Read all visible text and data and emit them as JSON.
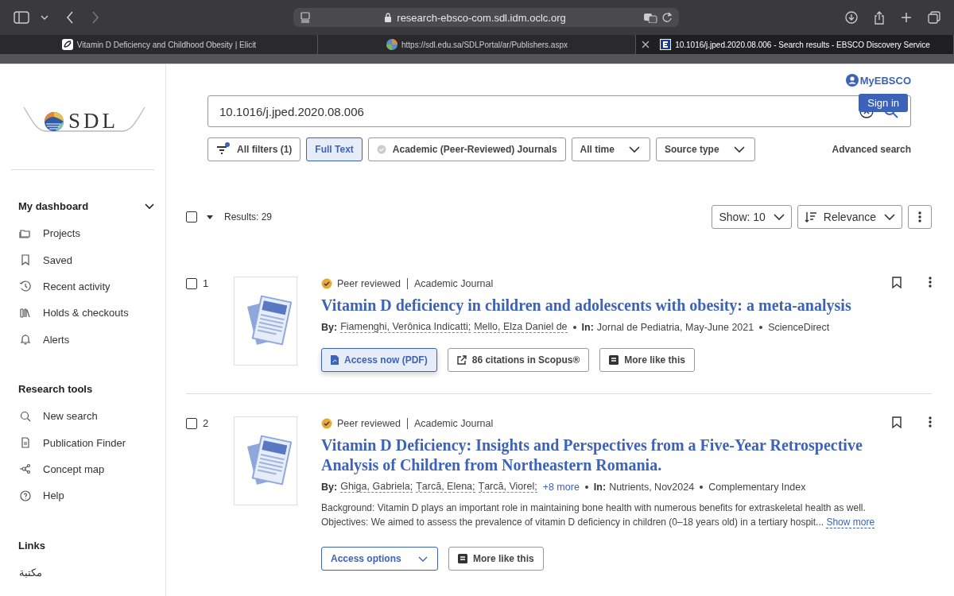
{
  "browser": {
    "url": "research-ebsco-com.sdl.idm.oclc.org",
    "tabs": [
      {
        "title": "Vitamin D Deficiency and Childhood Obesity | Elicit",
        "selected": false,
        "close_visible": false
      },
      {
        "title": "https://sdl.edu.sa/SDLPortal/ar/Publishers.aspx",
        "selected": false,
        "close_visible": false
      },
      {
        "title": "10.1016/j.jped.2020.08.006 - Search results - EBSCO Discovery Service",
        "selected": true,
        "close_visible": true
      }
    ]
  },
  "sidebar": {
    "logo": "SDL",
    "sections": [
      {
        "heading": "My dashboard",
        "expanded": true,
        "items": [
          {
            "label": "Projects"
          },
          {
            "label": "Saved"
          },
          {
            "label": "Recent activity"
          },
          {
            "label": "Holds & checkouts"
          },
          {
            "label": "Alerts"
          }
        ]
      },
      {
        "heading": "Research tools",
        "items": [
          {
            "label": "New search"
          },
          {
            "label": "Publication Finder"
          },
          {
            "label": "Concept map"
          },
          {
            "label": "Help"
          }
        ]
      },
      {
        "heading": "Links",
        "items": [
          {
            "label": "مكتبة"
          }
        ]
      }
    ]
  },
  "account": {
    "label": "MyEBSCO",
    "tooltip": "Sign in"
  },
  "search": {
    "value": "10.1016/j.jped.2020.08.006"
  },
  "filters": [
    {
      "kind": "filters",
      "label": "All filters (1)",
      "selected": false
    },
    {
      "kind": "toggle",
      "label": "Full Text",
      "selected": true
    },
    {
      "kind": "toggle",
      "label": "Academic (Peer-Reviewed) Journals",
      "selected": false
    },
    {
      "kind": "dropdown",
      "label": "All time",
      "selected": false
    },
    {
      "kind": "dropdown",
      "label": "Source type",
      "selected": false
    }
  ],
  "advanced_search": "Advanced search",
  "results_bar": {
    "checked": false,
    "count": "Results: 29",
    "show": "Show: 10",
    "sort": "Relevance"
  },
  "results": [
    {
      "number": "1",
      "checked": false,
      "peer_reviewed": "Peer reviewed",
      "type": "Academic Journal",
      "title": "Vitamin D deficiency in children and adolescents with obesity: a meta-analysis",
      "by_label": "By:",
      "authors": [
        "Fiamenghi, Verônica Indicatti;",
        "Mello, Elza Daniel de"
      ],
      "in_label": "In:",
      "source": "Jornal de Pediatria, May-June 2021",
      "database": "ScienceDirect",
      "actions": [
        {
          "kind": "primary",
          "label": "Access now (PDF)"
        },
        {
          "kind": "external",
          "label": "86 citations in Scopus®"
        },
        {
          "kind": "similar",
          "label": "More like this"
        }
      ]
    },
    {
      "number": "2",
      "checked": false,
      "peer_reviewed": "Peer reviewed",
      "type": "Academic Journal",
      "title": "Vitamin D Deficiency: Insights and Perspectives from a Five-Year Retrospective Analysis of Children from Northeastern Romania.",
      "by_label": "By:",
      "authors": [
        "Ghiga, Gabriela;",
        "Țarcă, Elena;",
        "Țarcă, Viorel;"
      ],
      "more_authors": "+8 more",
      "in_label": "In:",
      "source": "Nutrients, Nov2024",
      "database": "Complementary Index",
      "abstract": "Background: Vitamin D plays an important role in maintaining bone health with numerous benefits for extraskeletal health as well. Objectives: We aimed to assess the prevalence of vitamin D deficiency in children (0–18 years old) in a tertiary hospit...",
      "show_more": "Show more",
      "actions": [
        {
          "kind": "options",
          "label": "Access options"
        },
        {
          "kind": "similar",
          "label": "More like this"
        }
      ]
    }
  ]
}
